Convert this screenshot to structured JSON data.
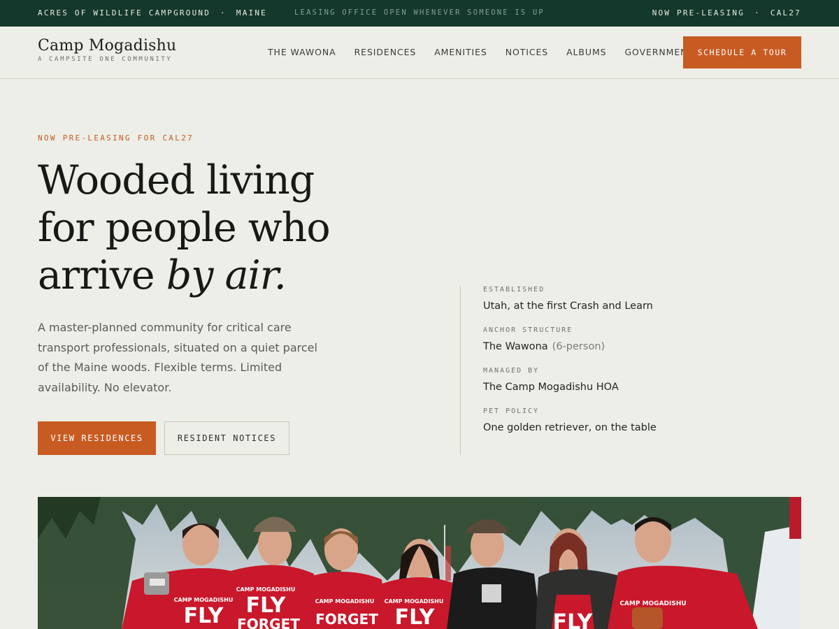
{
  "topbar": {
    "left_a": "ACRES OF WILDLIFE CAMPGROUND",
    "left_sep": "·",
    "left_b": "MAINE",
    "center": "LEASING OFFICE OPEN WHENEVER SOMEONE IS UP",
    "right_a": "NOW PRE-LEASING",
    "right_sep": "·",
    "right_b": "CAL27"
  },
  "brand": {
    "name": "Camp Mogadishu",
    "tagline": "A CAMPSITE ONE COMMUNITY"
  },
  "nav": {
    "items": [
      "THE WAWONA",
      "RESIDENCES",
      "AMENITIES",
      "NOTICES",
      "ALBUMS",
      "GOVERNMENT"
    ],
    "cta": "SCHEDULE A TOUR"
  },
  "hero": {
    "eyebrow": "NOW PRE-LEASING FOR CAL27",
    "headline_line1": "Wooded living",
    "headline_line2": "for people who",
    "headline_line3_plain": "arrive ",
    "headline_line3_italic": "by air.",
    "lead": "A master-planned community for critical care transport professionals, situated on a quiet parcel of the Maine woods. Flexible terms. Limited availability. No elevator.",
    "primary_button": "VIEW RESIDENCES",
    "secondary_button": "RESIDENT NOTICES"
  },
  "facts": [
    {
      "label": "ESTABLISHED",
      "value": "Utah, at the first Crash and Learn",
      "note": ""
    },
    {
      "label": "ANCHOR STRUCTURE",
      "value": "The Wawona",
      "note": "(6-person)"
    },
    {
      "label": "MANAGED BY",
      "value": "The Camp Mogadishu HOA",
      "note": ""
    },
    {
      "label": "PET POLICY",
      "value": "One golden retriever, on the table",
      "note": ""
    }
  ],
  "photo": {
    "shirt_text_top": "CAMP MOGADISHU",
    "shirt_text_main": "FLY",
    "shirt_text_sub": "FORGET",
    "colors": {
      "shirt": "#c9182b",
      "trees": "#2f4a2f",
      "sky": "#b9c7cf"
    }
  },
  "colors": {
    "accent": "#c85b22",
    "topbar": "#14382b",
    "background": "#eceee7"
  }
}
